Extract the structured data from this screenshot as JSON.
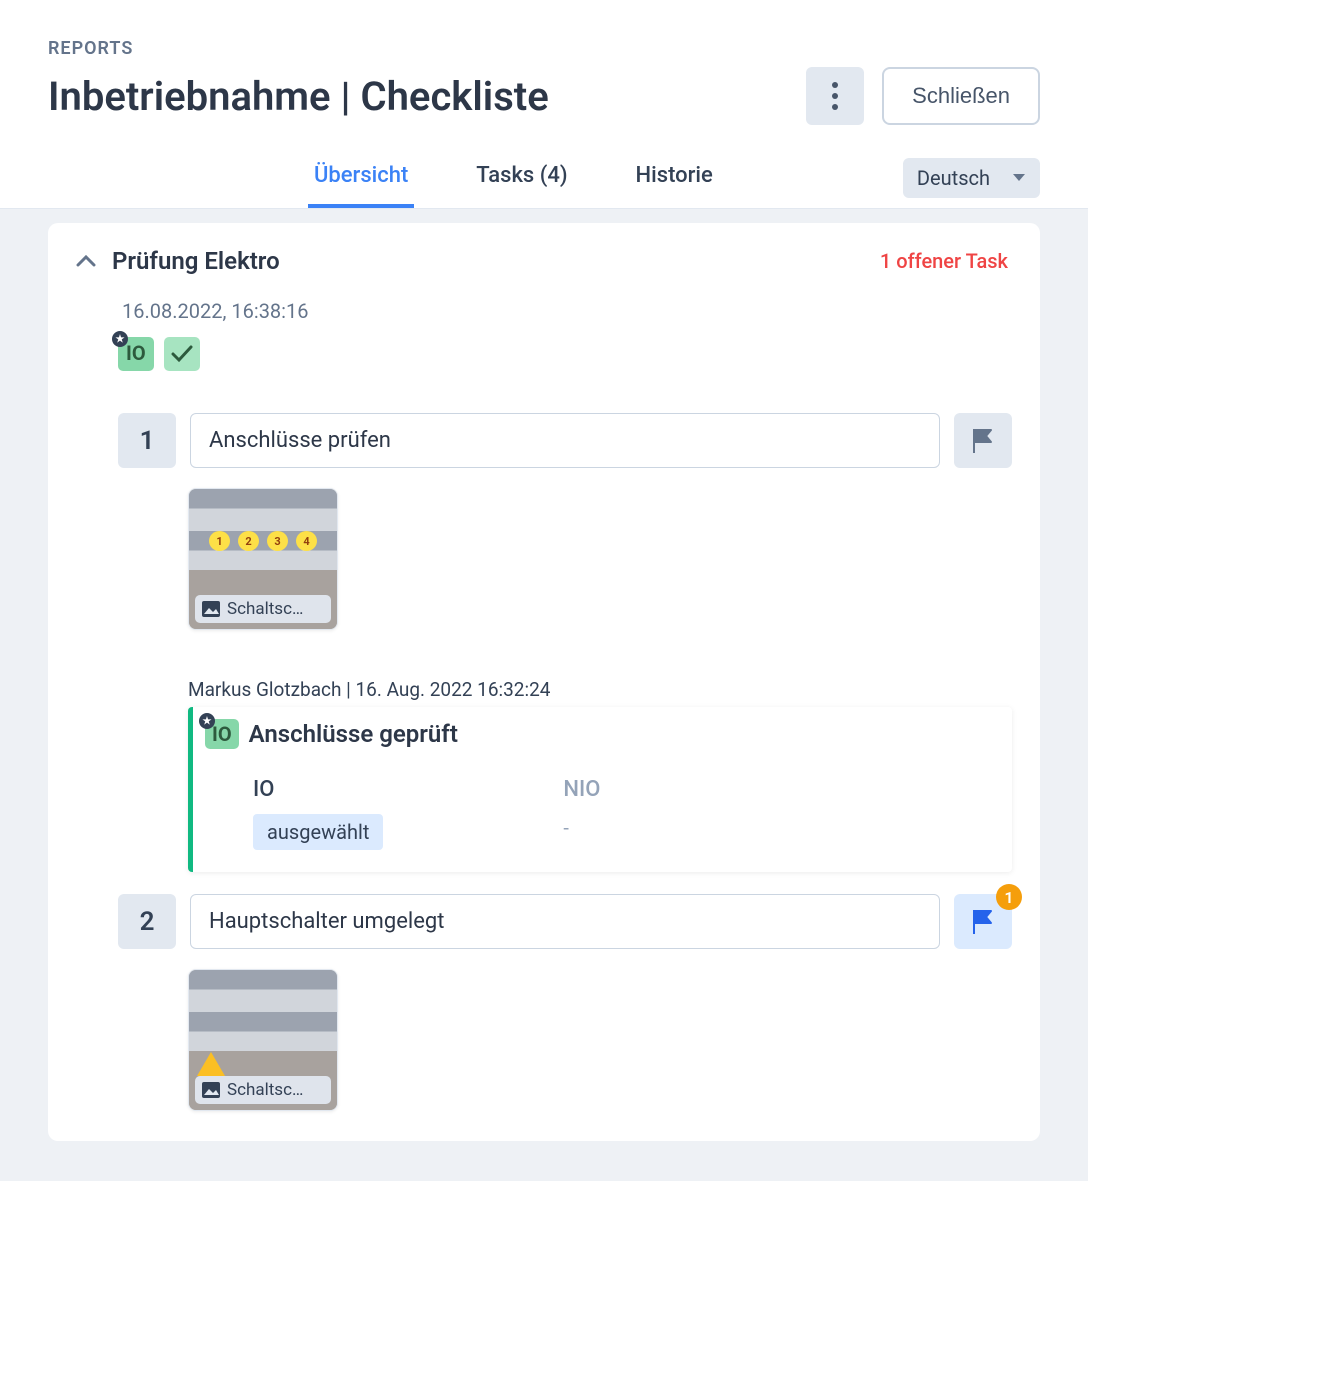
{
  "breadcrumb": "REPORTS",
  "page_title": "Inbetriebnahme | Checkliste",
  "close_label": "Schließen",
  "tabs": {
    "overview": "Übersicht",
    "tasks": "Tasks (4)",
    "history": "Historie"
  },
  "language": "Deutsch",
  "section": {
    "title": "Prüfung Elektro",
    "open_tasks": "1 offener Task",
    "timestamp": "16.08.2022, 16:38:16",
    "badge_io": "IO"
  },
  "steps": [
    {
      "num": "1",
      "title": "Anschlüsse prüfen",
      "thumb_label": "Schaltsc…",
      "has_flag_badge": false
    },
    {
      "num": "2",
      "title": "Hauptschalter umgelegt",
      "thumb_label": "Schaltsc…",
      "has_flag_badge": true,
      "flag_count": "1"
    }
  ],
  "result": {
    "meta": "Markus Glotzbach | 16. Aug. 2022 16:32:24",
    "badge": "IO",
    "title": "Anschlüsse geprüft",
    "col_io": "IO",
    "col_nio": "NIO",
    "selected": "ausgewählt",
    "nio_value": "-"
  }
}
